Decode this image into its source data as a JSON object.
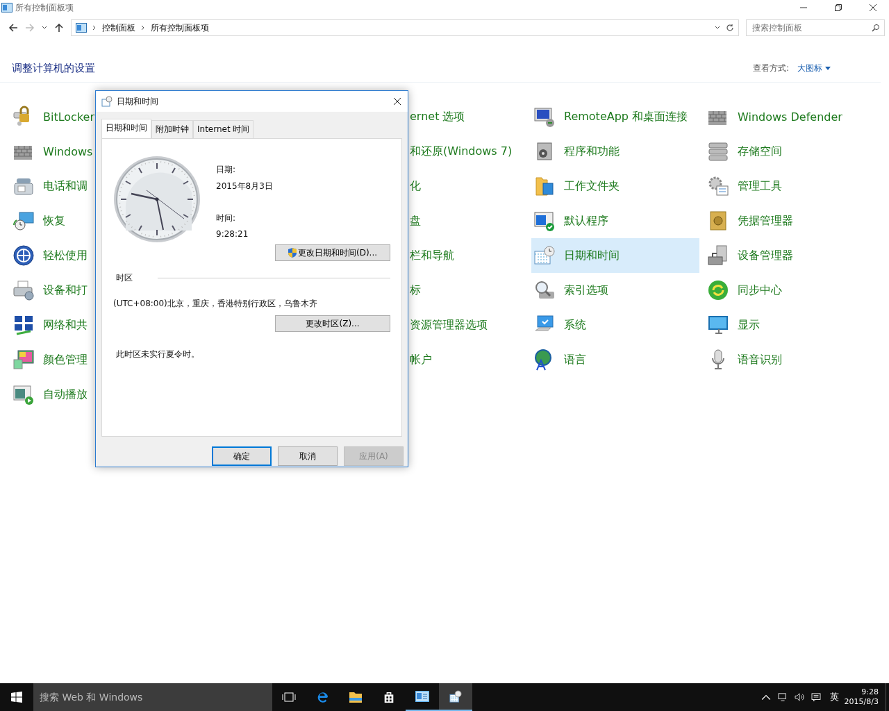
{
  "window": {
    "title": "所有控制面板项"
  },
  "address": {
    "breadcrumb": [
      "控制面板",
      "所有控制面板项"
    ],
    "search_placeholder": "搜索控制面板"
  },
  "heading": "调整计算机的设置",
  "view_by": {
    "label": "查看方式:",
    "value": "大图标"
  },
  "columns": [
    {
      "kind": "full",
      "items": [
        {
          "label": "BitLocker",
          "selected": false
        },
        {
          "label": "Windows",
          "selected": false
        },
        {
          "label": "电话和调",
          "selected": false
        },
        {
          "label": "恢复",
          "selected": false
        },
        {
          "label": "轻松使用",
          "selected": false
        },
        {
          "label": "设备和打",
          "selected": false
        },
        {
          "label": "网络和共",
          "selected": false
        },
        {
          "label": "颜色管理",
          "selected": false
        },
        {
          "label": "自动播放",
          "selected": false
        }
      ]
    },
    {
      "kind": "covered",
      "items": [
        {
          "label": "ernet 选项"
        },
        {
          "label": "和还原(Windows 7)"
        },
        {
          "label": "化"
        },
        {
          "label": "盘"
        },
        {
          "label": "栏和导航"
        },
        {
          "label": "标"
        },
        {
          "label": "资源管理器选项"
        },
        {
          "label": "帐户"
        }
      ]
    },
    {
      "kind": "full",
      "items": [
        {
          "label": "RemoteApp 和桌面连接",
          "selected": false
        },
        {
          "label": "程序和功能",
          "selected": false
        },
        {
          "label": "工作文件夹",
          "selected": false
        },
        {
          "label": "默认程序",
          "selected": false
        },
        {
          "label": "日期和时间",
          "selected": true
        },
        {
          "label": "索引选项",
          "selected": false
        },
        {
          "label": "系统",
          "selected": false
        },
        {
          "label": "语言",
          "selected": false
        }
      ]
    },
    {
      "kind": "full",
      "items": [
        {
          "label": "Windows Defender",
          "selected": false
        },
        {
          "label": "存储空间",
          "selected": false
        },
        {
          "label": "管理工具",
          "selected": false
        },
        {
          "label": "凭据管理器",
          "selected": false
        },
        {
          "label": "设备管理器",
          "selected": false
        },
        {
          "label": "同步中心",
          "selected": false
        },
        {
          "label": "显示",
          "selected": false
        },
        {
          "label": "语音识别",
          "selected": false
        }
      ]
    }
  ],
  "dialog": {
    "title": "日期和时间",
    "tabs": [
      {
        "label": "日期和时间",
        "selected": true
      },
      {
        "label": "附加时钟",
        "selected": false
      },
      {
        "label": "Internet 时间",
        "selected": false
      }
    ],
    "date_label": "日期:",
    "date": "2015年8月3日",
    "time_label": "时间:",
    "time": "9:28:21",
    "change_datetime_button": "更改日期和时间(D)...",
    "timezone_group": "时区",
    "timezone": "(UTC+08:00)北京，重庆，香港特别行政区，乌鲁木齐",
    "change_timezone_button": "更改时区(Z)...",
    "dst_note": "此时区未实行夏令时。",
    "buttons": [
      {
        "label": "确定",
        "default": true,
        "disabled": false
      },
      {
        "label": "取消",
        "default": false,
        "disabled": false
      },
      {
        "label": "应用(A)",
        "default": false,
        "disabled": true
      }
    ]
  },
  "taskbar": {
    "search_placeholder": "搜索 Web 和 Windows",
    "apps": [
      {
        "running": false
      },
      {
        "running": false
      },
      {
        "running": false
      },
      {
        "running": false
      },
      {
        "running": true
      },
      {
        "running": true
      }
    ],
    "ime": "英",
    "time": "9:28",
    "date": "2015/8/3"
  }
}
